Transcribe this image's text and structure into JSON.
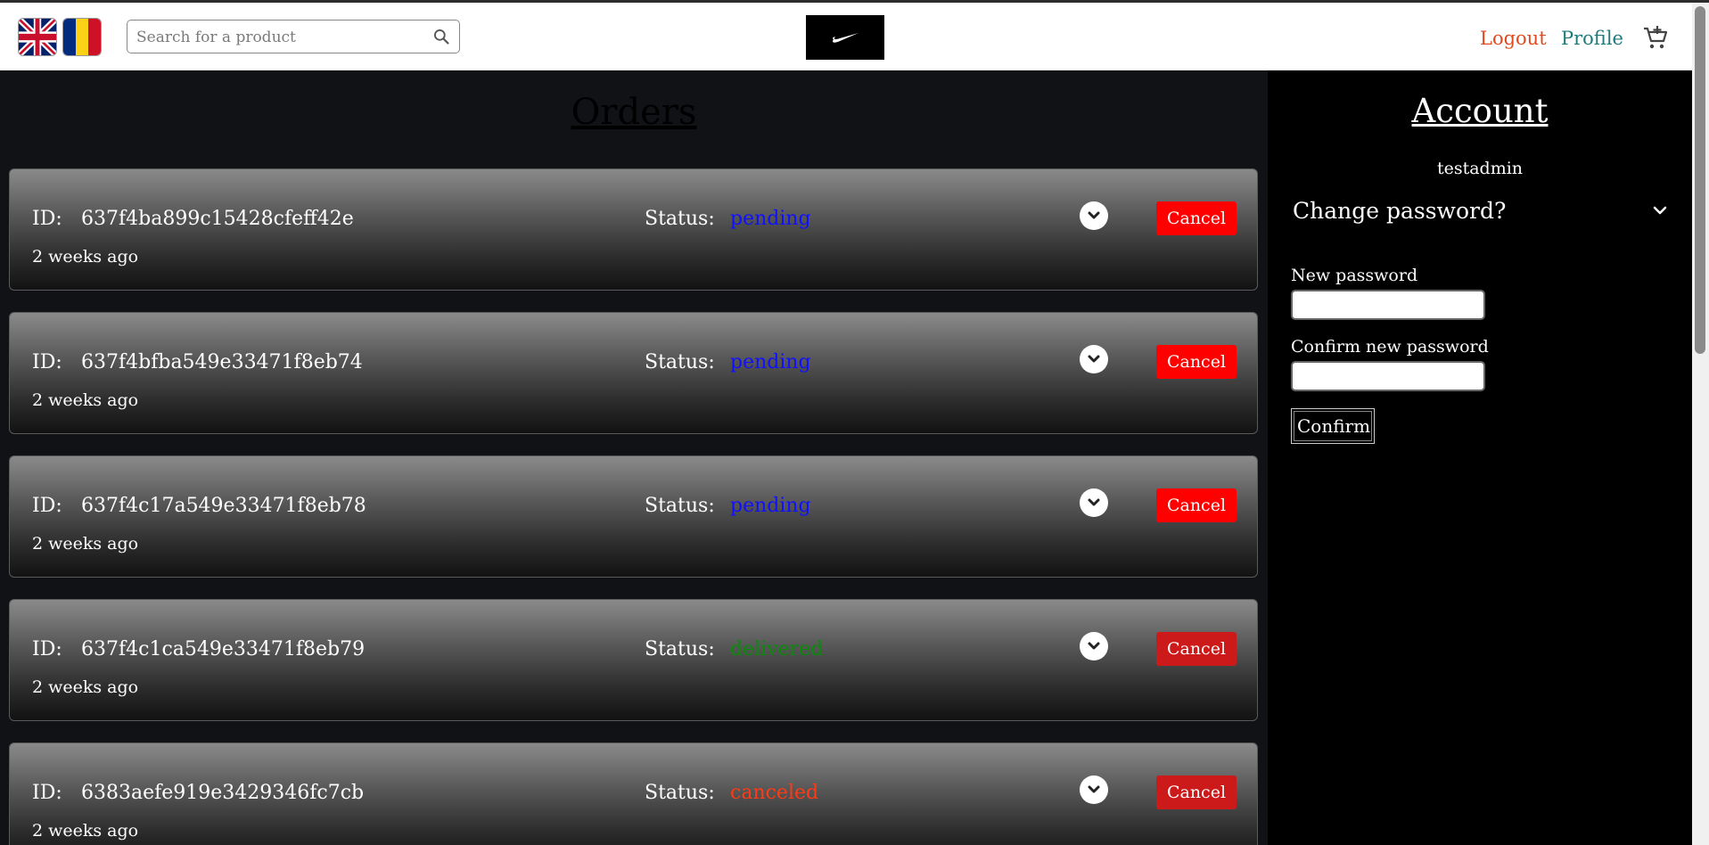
{
  "header": {
    "flags": [
      {
        "name": "uk-flag-icon"
      },
      {
        "name": "romania-flag-icon"
      }
    ],
    "search": {
      "placeholder": "Search for a product",
      "value": ""
    },
    "logo": "nike-swoosh-icon",
    "nav": {
      "logout": "Logout",
      "profile": "Profile"
    },
    "cart_icon": "cart-add-icon",
    "colors": {
      "logout": "#e04a1e",
      "profile": "#1f7a7a"
    }
  },
  "orders": {
    "title": "Orders",
    "id_label": "ID:",
    "status_label": "Status:",
    "cancel_label": "Cancel",
    "items": [
      {
        "id": "637f4ba899c15428cfeff42e",
        "status": "pending",
        "status_color": "#1010ff",
        "time": "2 weeks ago",
        "cancel_color": "#ff0000"
      },
      {
        "id": "637f4bfba549e33471f8eb74",
        "status": "pending",
        "status_color": "#1010ff",
        "time": "2 weeks ago",
        "cancel_color": "#ff0000"
      },
      {
        "id": "637f4c17a549e33471f8eb78",
        "status": "pending",
        "status_color": "#1010ff",
        "time": "2 weeks ago",
        "cancel_color": "#ff0000"
      },
      {
        "id": "637f4c1ca549e33471f8eb79",
        "status": "delivered",
        "status_color": "#0a8a0a",
        "time": "2 weeks ago",
        "cancel_color": "#cc1a1a"
      },
      {
        "id": "6383aefe919e3429346fc7cb",
        "status": "canceled",
        "status_color": "#ff3a14",
        "time": "2 weeks ago",
        "cancel_color": "#cc1a1a"
      }
    ]
  },
  "account": {
    "title": "Account",
    "username": "testadmin",
    "change_password": "Change password?",
    "new_password_label": "New password",
    "confirm_password_label": "Confirm new password",
    "new_password_value": "",
    "confirm_password_value": "",
    "confirm_button": "Confirm"
  }
}
